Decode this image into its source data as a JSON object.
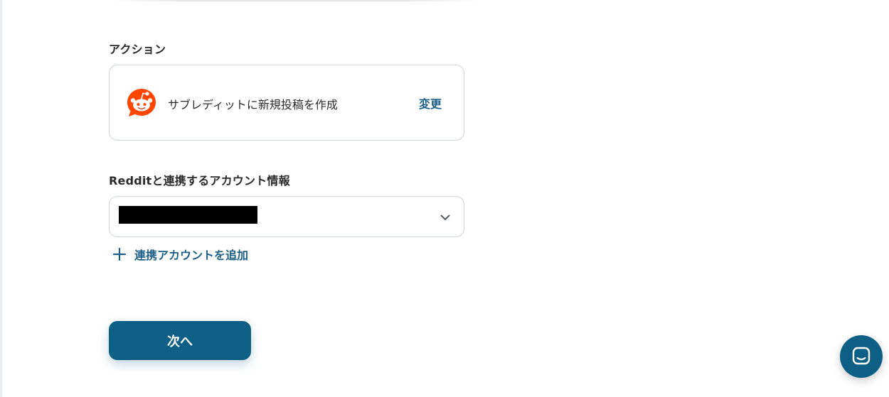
{
  "action": {
    "section_label": "アクション",
    "app_icon": "reddit-icon",
    "name": "サブレディットに新規投稿を作成",
    "change_label": "変更"
  },
  "account": {
    "section_label": "Redditと連携するアカウント情報",
    "selected_value_redacted": true,
    "dropdown_icon": "chevron-down-icon",
    "add_icon": "plus-icon",
    "add_label": "連携アカウントを追加"
  },
  "footer": {
    "next_label": "次へ"
  },
  "chat": {
    "icon": "chat-bubble-icon"
  },
  "colors": {
    "accent": "#0e5f86",
    "link": "#1d5f86",
    "reddit_orange": "#ff4500",
    "border": "#cfd4da",
    "text": "#2b2b2b"
  }
}
